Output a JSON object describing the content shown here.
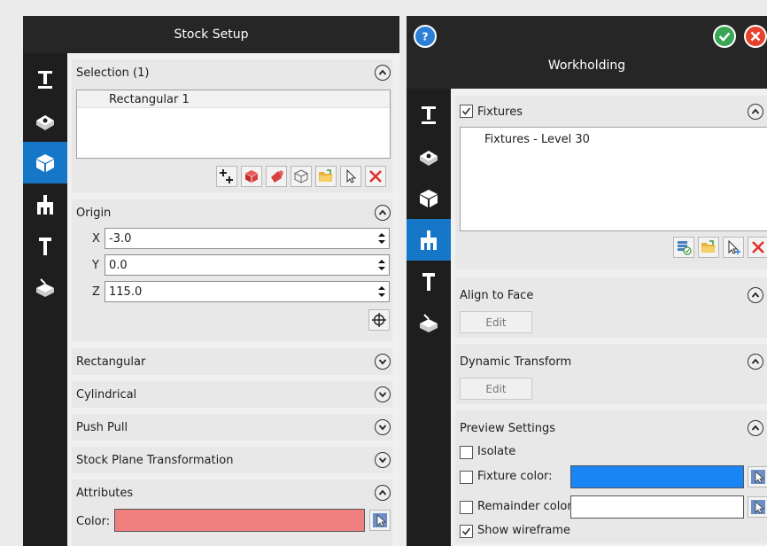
{
  "left_panel": {
    "title": "Stock Setup",
    "selection": {
      "title": "Selection (1)",
      "items": [
        "Rectangular 1"
      ]
    },
    "origin": {
      "title": "Origin",
      "fields": [
        {
          "label": "X",
          "value": "-3.0"
        },
        {
          "label": "Y",
          "value": "0.0"
        },
        {
          "label": "Z",
          "value": "115.0"
        }
      ]
    },
    "collapsed_sections": [
      "Rectangular",
      "Cylindrical",
      "Push Pull",
      "Stock Plane Transformation"
    ],
    "attributes": {
      "title": "Attributes",
      "color_label": "Color:",
      "color": "#f08080"
    }
  },
  "right_panel": {
    "title": "Workholding",
    "fixtures": {
      "title": "Fixtures",
      "checked": true,
      "items": [
        "Fixtures - Level 30"
      ]
    },
    "align_to_face": {
      "title": "Align to Face",
      "button": "Edit"
    },
    "dynamic_transform": {
      "title": "Dynamic Transform",
      "button": "Edit"
    },
    "preview_settings": {
      "title": "Preview Settings",
      "isolate": {
        "label": "Isolate",
        "checked": false
      },
      "fixture_color": {
        "label": "Fixture color:",
        "checked": false,
        "color": "#1a85f5"
      },
      "remainder_color": {
        "label": "Remainder color:",
        "checked": false,
        "color": "#ffffff"
      },
      "show_wireframe": {
        "label": "Show wireframe",
        "checked": true
      }
    }
  },
  "colors": {
    "accent": "#1677c8",
    "rail": "#1e1e1e",
    "titlebar": "#262626",
    "ok": "#3aa655",
    "cancel": "#e8412c",
    "help": "#2b7fd6"
  }
}
